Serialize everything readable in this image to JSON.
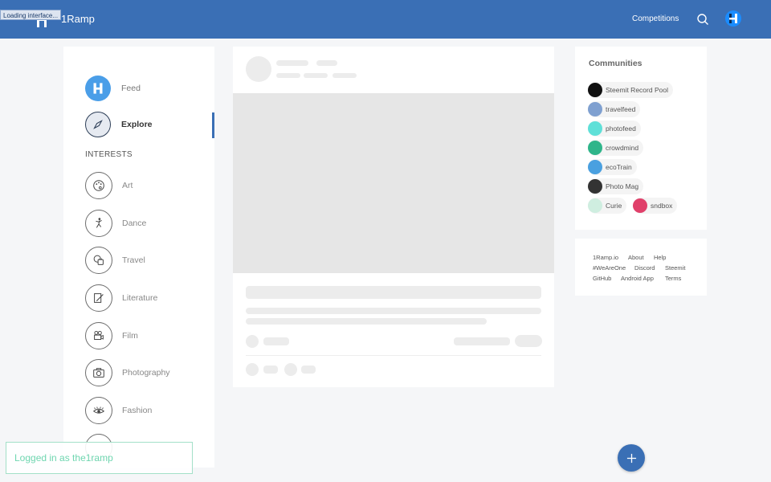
{
  "app": {
    "loading_text": "Loading interface...",
    "logo_text": "1Ramp"
  },
  "header": {
    "competitions_label": "Competitions"
  },
  "sidebar": {
    "feed_label": "Feed",
    "explore_label": "Explore",
    "interests_heading": "INTERESTS",
    "interests": [
      "Art",
      "Dance",
      "Travel",
      "Literature",
      "Film",
      "Photography",
      "Fashion"
    ]
  },
  "communities": {
    "title": "Communities",
    "items": [
      {
        "name": "Steemit Record Pool",
        "color": "#111111"
      },
      {
        "name": "travelfeed",
        "color": "#7fa0d0"
      },
      {
        "name": "photofeed",
        "color": "#5fe0d8"
      },
      {
        "name": "crowdmind",
        "color": "#2fb58a"
      },
      {
        "name": "ecoTrain",
        "color": "#4aa0e0"
      },
      {
        "name": "Photo Mag",
        "color": "#333333"
      },
      {
        "name": "Curie",
        "color": "#cfeee0"
      },
      {
        "name": "sndbox",
        "color": "#e0406a"
      }
    ]
  },
  "footer_links": [
    "1Ramp.io",
    "About",
    "Help",
    "#WeAreOne",
    "Discord",
    "Steemit",
    "GitHub",
    "Android App",
    "Terms"
  ],
  "status": {
    "logged_in_text": "Logged in as the1ramp"
  },
  "colors": {
    "brand": "#3a6fb5",
    "toast": "#6fd6b0"
  }
}
